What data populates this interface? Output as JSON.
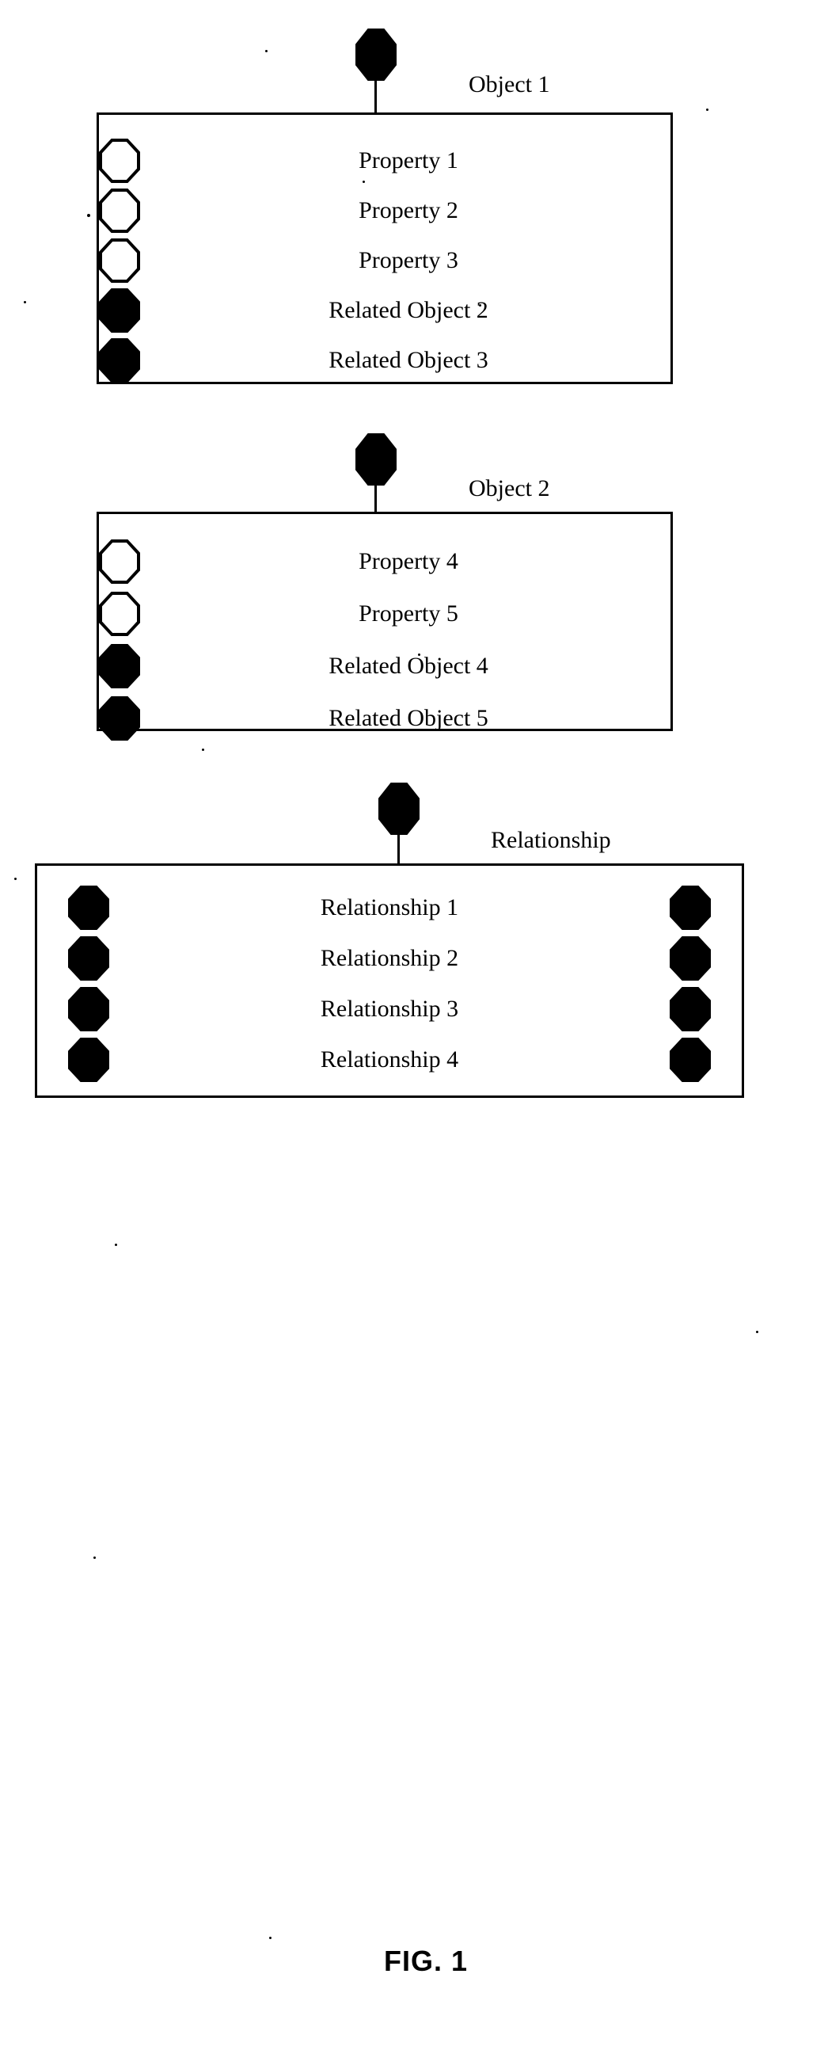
{
  "figure": {
    "caption": "FIG. 1",
    "background_color": "#ffffff",
    "ink_color": "#000000"
  },
  "groups": [
    {
      "id": "object-1",
      "node_label": "Object 1",
      "node_icon": "filled-octagon-icon",
      "rows": [
        {
          "label": "Property 1",
          "icon": "hollow-octagon-icon",
          "style": "hollow"
        },
        {
          "label": "Property 2",
          "icon": "hollow-octagon-icon",
          "style": "hollow"
        },
        {
          "label": "Property 3",
          "icon": "hollow-octagon-icon",
          "style": "hollow"
        },
        {
          "label": "Related Object 2",
          "icon": "filled-octagon-icon",
          "style": "filled"
        },
        {
          "label": "Related Object 3",
          "icon": "filled-octagon-icon",
          "style": "filled"
        }
      ]
    },
    {
      "id": "object-2",
      "node_label": "Object 2",
      "node_icon": "filled-octagon-icon",
      "rows": [
        {
          "label": "Property 4",
          "icon": "hollow-octagon-icon",
          "style": "hollow"
        },
        {
          "label": "Property 5",
          "icon": "hollow-octagon-icon",
          "style": "hollow"
        },
        {
          "label": "Related Object 4",
          "icon": "filled-octagon-icon",
          "style": "filled"
        },
        {
          "label": "Related Object 5",
          "icon": "filled-octagon-icon",
          "style": "filled"
        }
      ]
    },
    {
      "id": "relationship",
      "node_label": "Relationship",
      "node_icon": "filled-octagon-icon",
      "rows": [
        {
          "label": "Relationship 1",
          "icon": "filled-octagon-icon",
          "style": "filled",
          "right_icon": "filled-octagon-icon"
        },
        {
          "label": "Relationship 2",
          "icon": "filled-octagon-icon",
          "style": "filled",
          "right_icon": "filled-octagon-icon"
        },
        {
          "label": "Relationship 3",
          "icon": "filled-octagon-icon",
          "style": "filled",
          "right_icon": "filled-octagon-icon"
        },
        {
          "label": "Relationship 4",
          "icon": "filled-octagon-icon",
          "style": "filled",
          "right_icon": "filled-octagon-icon"
        }
      ]
    }
  ]
}
